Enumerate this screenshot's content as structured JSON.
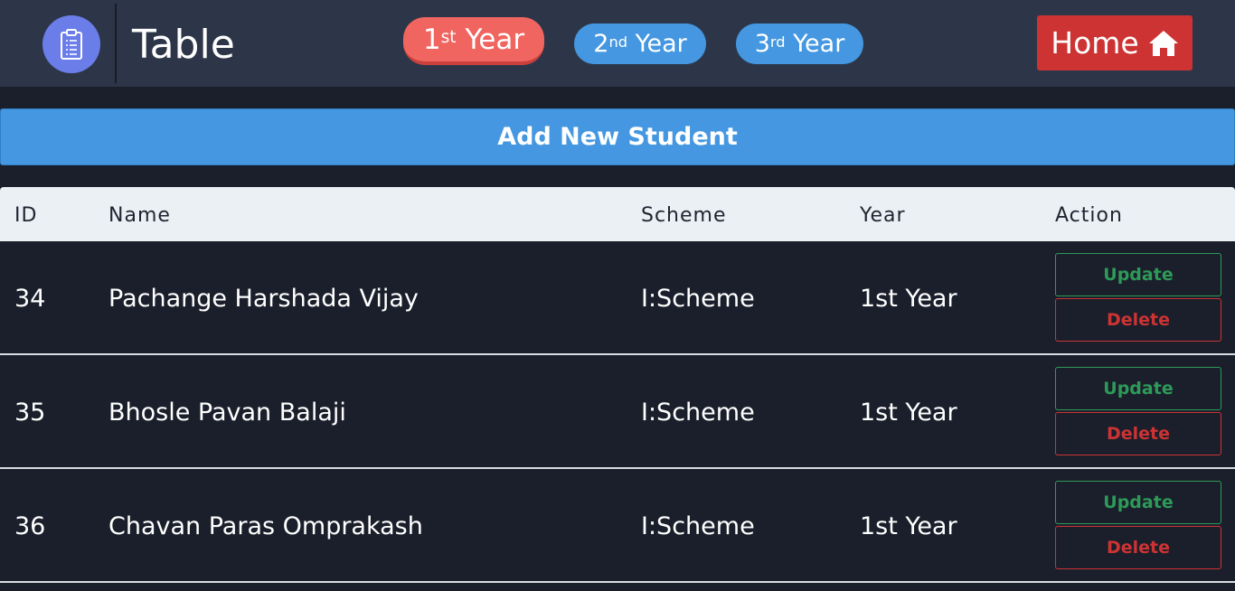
{
  "brand": {
    "title": "Table",
    "icon": "clipboard-icon"
  },
  "nav": {
    "years": [
      {
        "base": "1",
        "suffix": "st",
        "word": " Year",
        "active": true
      },
      {
        "base": "2",
        "suffix": "nd",
        "word": " Year",
        "active": false
      },
      {
        "base": "3",
        "suffix": "rd",
        "word": " Year",
        "active": false
      }
    ],
    "home_label": "Home",
    "home_icon": "home-icon"
  },
  "add_button_label": "Add New Student",
  "table": {
    "headers": {
      "id": "ID",
      "name": "Name",
      "scheme": "Scheme",
      "year": "Year",
      "action": "Action"
    },
    "rows": [
      {
        "id": "34",
        "name": "Pachange Harshada Vijay",
        "scheme": "I:Scheme",
        "year": "1st Year",
        "update_label": "Update",
        "delete_label": "Delete"
      },
      {
        "id": "35",
        "name": "Bhosle Pavan Balaji",
        "scheme": "I:Scheme",
        "year": "1st Year",
        "update_label": "Update",
        "delete_label": "Delete"
      },
      {
        "id": "36",
        "name": "Chavan Paras Omprakash",
        "scheme": "I:Scheme",
        "year": "1st Year",
        "update_label": "Update",
        "delete_label": "Delete"
      }
    ]
  },
  "colors": {
    "background": "#1b1f2b",
    "navbar": "#2d3648",
    "active_pill": "#f06560",
    "pill": "#4497e0",
    "home": "#cd3333",
    "update": "#2d9a58",
    "delete": "#cd3333"
  }
}
